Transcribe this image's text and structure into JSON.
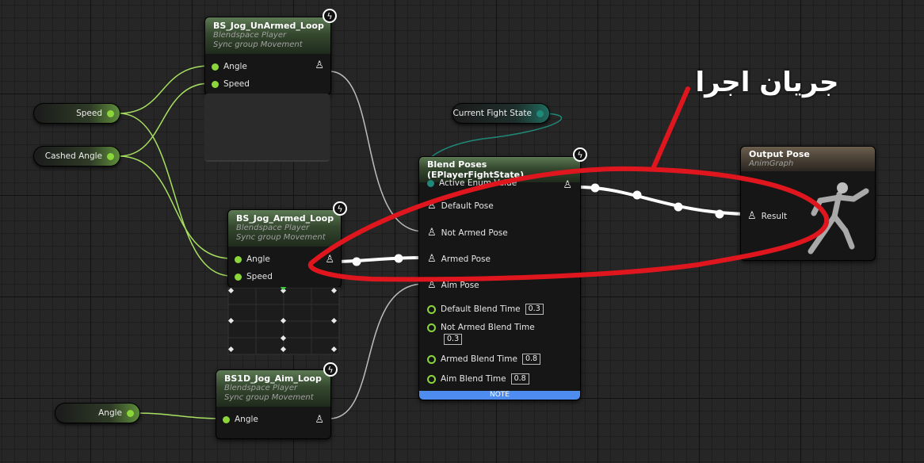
{
  "nodes": {
    "unarmed": {
      "title": "BS_Jog_UnArmed_Loop",
      "sub1": "Blendspace Player",
      "sub2": "Sync group Movement",
      "pins": [
        "Angle",
        "Speed"
      ]
    },
    "armed": {
      "title": "BS_Jog_Armed_Loop",
      "sub1": "Blendspace Player",
      "sub2": "Sync group Movement",
      "pins": [
        "Angle",
        "Speed"
      ]
    },
    "aim": {
      "title": "BS1D_Jog_Aim_Loop",
      "sub1": "Blendspace Player",
      "sub2": "Sync group Movement",
      "pins": [
        "Angle"
      ]
    },
    "blend": {
      "title": "Blend Poses (EPlayerFightState)",
      "active": "Active Enum Value",
      "pose_pins": [
        "Default Pose",
        "Not Armed Pose",
        "Armed Pose",
        "Aim Pose"
      ],
      "times": [
        {
          "label": "Default Blend Time",
          "value": "0.3"
        },
        {
          "label": "Not Armed Blend Time",
          "value": "0.3"
        },
        {
          "label": "Armed Blend Time",
          "value": "0.8"
        },
        {
          "label": "Aim Blend Time",
          "value": "0.8"
        }
      ],
      "note": "NOTE"
    },
    "output": {
      "title": "Output Pose",
      "sub": "AnimGraph",
      "pin": "Result"
    }
  },
  "variables": {
    "speed": "Speed",
    "cashed_angle": "Cashed Angle",
    "current_fight_state": "Current Fight State",
    "angle": "Angle"
  },
  "annotation": {
    "text": "جریان اجرا",
    "color": "#e0161f"
  },
  "colors": {
    "float_pin": "#8bd63a",
    "enum_pin": "#1f8a7a",
    "note_bar": "#4f8cf0"
  },
  "icons": [
    "bolt-icon",
    "pose-pin-icon",
    "mannequin-icon"
  ]
}
